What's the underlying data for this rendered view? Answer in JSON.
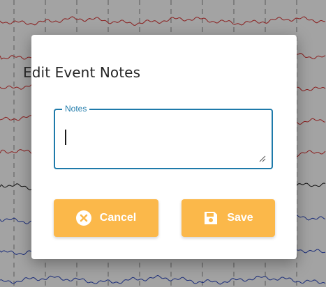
{
  "dialog": {
    "title": "Edit Event Notes",
    "notes_field": {
      "label": "Notes",
      "value": "",
      "placeholder": ""
    },
    "buttons": {
      "cancel_label": "Cancel",
      "cancel_icon": "cancel-circle-icon",
      "save_label": "Save",
      "save_icon": "floppy-disk-icon"
    }
  },
  "colors": {
    "overlay_gray": "#a3a3a3",
    "accent_blue": "#1e7aaa",
    "button_orange": "#fbb84a",
    "trace_red": "#8b1f1f",
    "trace_black": "#111111",
    "trace_navy": "#1b2d7a"
  }
}
